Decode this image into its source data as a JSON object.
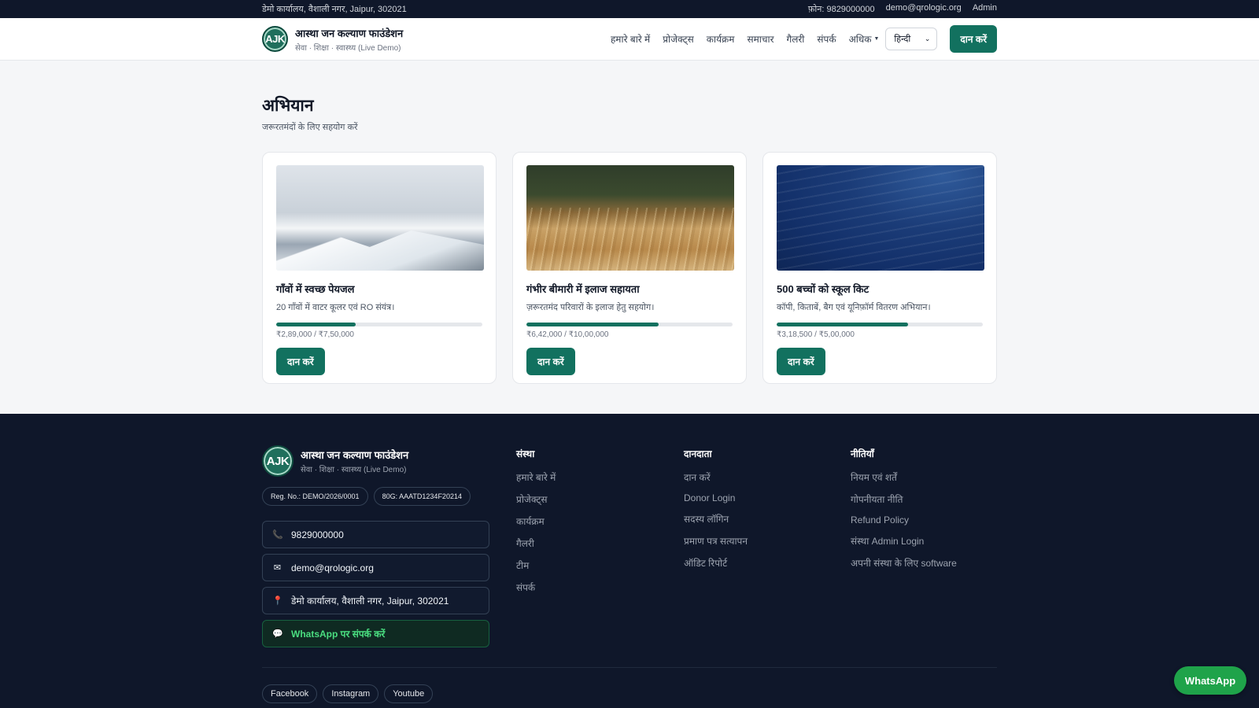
{
  "topbar": {
    "address": "डेमो कार्यालय, वैशाली नगर, Jaipur, 302021",
    "phone": "फ़ोन: 9829000000",
    "email": "demo@qrologic.org",
    "admin": "Admin"
  },
  "header": {
    "logo_text": "AJK",
    "title": "आस्था जन कल्याण फाउंडेशन",
    "subtitle": "सेवा · शिक्षा · स्वास्थ्य (Live Demo)",
    "nav": [
      "हमारे बारे में",
      "प्रोजेक्ट्स",
      "कार्यक्रम",
      "समाचार",
      "गैलरी",
      "संपर्क"
    ],
    "more_label": "अधिक",
    "language": "हिन्दी",
    "donate_label": "दान करें"
  },
  "campaigns": {
    "title": "अभियान",
    "subtitle": "जरूरतमंदों के लिए सहयोग करें",
    "cards": [
      {
        "title": "गाँवों में स्वच्छ पेयजल",
        "desc": "20 गाँवों में वाटर कूलर एवं RO संयंत्र।",
        "raised": "₹2,89,000 / ₹7,50,000",
        "progress": 0.385,
        "button": "दान करें"
      },
      {
        "title": "गंभीर बीमारी में इलाज सहायता",
        "desc": "ज़रूरतमंद परिवारों के इलाज हेतु सहयोग।",
        "raised": "₹6,42,000 / ₹10,00,000",
        "progress": 0.642,
        "button": "दान करें"
      },
      {
        "title": "500 बच्चों को स्कूल किट",
        "desc": "कॉपी, किताबें, बैग एवं यूनिफ़ॉर्म वितरण अभियान।",
        "raised": "₹3,18,500 / ₹5,00,000",
        "progress": 0.637,
        "button": "दान करें"
      }
    ]
  },
  "footer": {
    "logo_text": "AJK",
    "title": "आस्था जन कल्याण फाउंडेशन",
    "subtitle": "सेवा · शिक्षा · स्वास्थ्य (Live Demo)",
    "reg": "Reg. No.: DEMO/2026/0001",
    "g80": "80G: AAATD1234F20214",
    "phone": "9829000000",
    "email": "demo@qrologic.org",
    "address": "डेमो कार्यालय, वैशाली नगर, Jaipur, 302021",
    "whatsapp": "WhatsApp पर संपर्क करें",
    "col1": {
      "title": "संस्था",
      "links": [
        "हमारे बारे में",
        "प्रोजेक्ट्स",
        "कार्यक्रम",
        "गैलरी",
        "टीम",
        "संपर्क"
      ]
    },
    "col2": {
      "title": "दानदाता",
      "links": [
        "दान करें",
        "Donor Login",
        "सदस्य लॉगिन",
        "प्रमाण पत्र सत्यापन",
        "ऑडिट रिपोर्ट"
      ]
    },
    "col3": {
      "title": "नीतियाँ",
      "links": [
        "नियम एवं शर्तें",
        "गोपनीयता नीति",
        "Refund Policy",
        "संस्था Admin Login",
        "अपनी संस्था के लिए software"
      ]
    },
    "socials": [
      "Facebook",
      "Instagram",
      "Youtube"
    ]
  },
  "whatsapp_float": "WhatsApp",
  "colors": {
    "primary": "#12715f",
    "dark": "#0f172a",
    "whatsapp": "#1fa34a"
  }
}
